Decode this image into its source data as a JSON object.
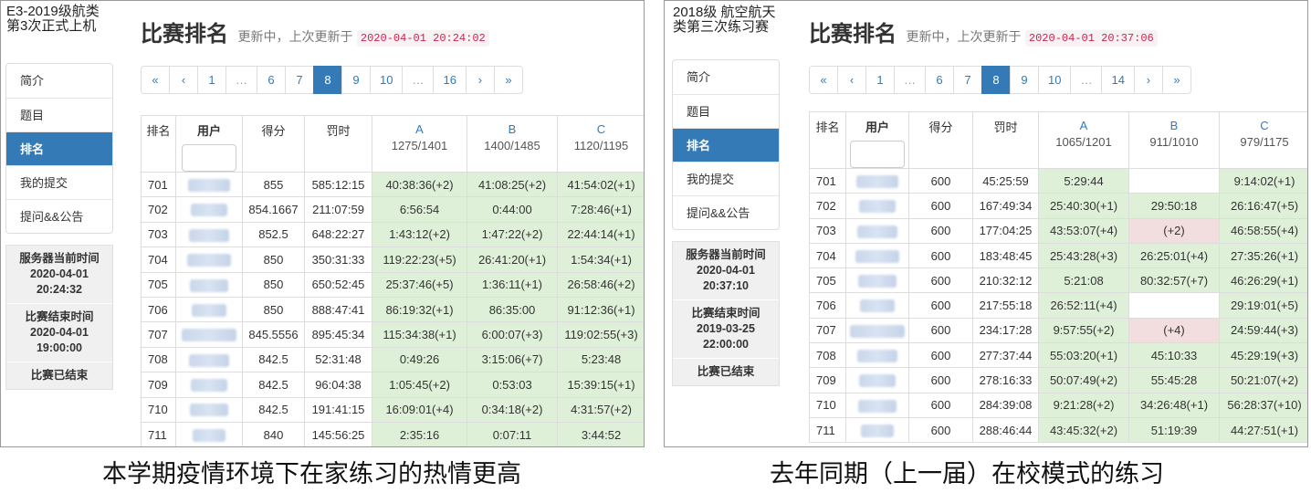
{
  "left": {
    "contest_title": "E3-2019级航类第3次正式上机",
    "nav": [
      "简介",
      "题目",
      "排名",
      "我的提交",
      "提问&&公告"
    ],
    "nav_active": 2,
    "info": {
      "server_time_label": "服务器当前时间",
      "server_date": "2020-04-01",
      "server_clock": "20:24:32",
      "end_label": "比赛结束时间",
      "end_date": "2020-04-01",
      "end_clock": "19:00:00",
      "status": "比赛已结束"
    },
    "heading": {
      "title": "比赛排名",
      "updating": "更新中，上次更新于",
      "timestamp": "2020-04-01 20:24:02"
    },
    "pagination": [
      "«",
      "‹",
      "1",
      "…",
      "6",
      "7",
      "8",
      "9",
      "10",
      "…",
      "16",
      "›",
      "»"
    ],
    "pagination_active": "8",
    "columns": {
      "rank": "排名",
      "user": "用户",
      "score": "得分",
      "penalty": "罚时"
    },
    "problems": [
      {
        "name": "A",
        "stat": "1275/1401"
      },
      {
        "name": "B",
        "stat": "1400/1485"
      },
      {
        "name": "C",
        "stat": "1120/1195"
      }
    ],
    "rows": [
      {
        "rank": "701",
        "score": "855",
        "penalty": "585:12:15",
        "a": "40:38:36(+2)",
        "b": "41:08:25(+2)",
        "c": "41:54:02(+1)"
      },
      {
        "rank": "702",
        "score": "854.1667",
        "penalty": "211:07:59",
        "a": "6:56:54",
        "b": "0:44:00",
        "c": "7:28:46(+1)"
      },
      {
        "rank": "703",
        "score": "852.5",
        "penalty": "648:22:27",
        "a": "1:43:12(+2)",
        "b": "1:47:22(+2)",
        "c": "22:44:14(+1)"
      },
      {
        "rank": "704",
        "score": "850",
        "penalty": "350:31:33",
        "a": "119:22:23(+5)",
        "b": "26:41:20(+1)",
        "c": "1:54:34(+1)"
      },
      {
        "rank": "705",
        "score": "850",
        "penalty": "650:52:45",
        "a": "25:37:46(+5)",
        "b": "1:36:11(+1)",
        "c": "26:58:46(+2)"
      },
      {
        "rank": "706",
        "score": "850",
        "penalty": "888:47:41",
        "a": "86:19:32(+1)",
        "b": "86:35:00",
        "c": "91:12:36(+1)"
      },
      {
        "rank": "707",
        "score": "845.5556",
        "penalty": "895:45:34",
        "a": "115:34:38(+1)",
        "b": "6:00:07(+3)",
        "c": "119:02:55(+3)"
      },
      {
        "rank": "708",
        "score": "842.5",
        "penalty": "52:31:48",
        "a": "0:49:26",
        "b": "3:15:06(+7)",
        "c": "5:23:48"
      },
      {
        "rank": "709",
        "score": "842.5",
        "penalty": "96:04:38",
        "a": "1:05:45(+2)",
        "b": "0:53:03",
        "c": "15:39:15(+1)"
      },
      {
        "rank": "710",
        "score": "842.5",
        "penalty": "191:41:15",
        "a": "16:09:01(+4)",
        "b": "0:34:18(+2)",
        "c": "4:31:57(+2)"
      },
      {
        "rank": "711",
        "score": "840",
        "penalty": "145:56:25",
        "a": "2:35:16",
        "b": "0:07:11",
        "c": "3:44:52"
      }
    ],
    "caption": "本学期疫情环境下在家练习的热情更高"
  },
  "right": {
    "contest_title": "2018级 航空航天类第三次练习赛",
    "nav": [
      "简介",
      "题目",
      "排名",
      "我的提交",
      "提问&&公告"
    ],
    "nav_active": 2,
    "info": {
      "server_time_label": "服务器当前时间",
      "server_date": "2020-04-01",
      "server_clock": "20:37:10",
      "end_label": "比赛结束时间",
      "end_date": "2019-03-25",
      "end_clock": "22:00:00",
      "status": "比赛已结束"
    },
    "heading": {
      "title": "比赛排名",
      "updating": "更新中，上次更新于",
      "timestamp": "2020-04-01 20:37:06"
    },
    "pagination": [
      "«",
      "‹",
      "1",
      "…",
      "6",
      "7",
      "8",
      "9",
      "10",
      "…",
      "14",
      "›",
      "»"
    ],
    "pagination_active": "8",
    "columns": {
      "rank": "排名",
      "user": "用户",
      "score": "得分",
      "penalty": "罚时"
    },
    "problems": [
      {
        "name": "A",
        "stat": "1065/1201"
      },
      {
        "name": "B",
        "stat": "911/1010"
      },
      {
        "name": "C",
        "stat": "979/1175"
      }
    ],
    "rows": [
      {
        "rank": "701",
        "score": "600",
        "penalty": "45:25:59",
        "a": "5:29:44",
        "b": "",
        "c": "9:14:02(+1)",
        "b_state": "none"
      },
      {
        "rank": "702",
        "score": "600",
        "penalty": "167:49:34",
        "a": "25:40:30(+1)",
        "b": "29:50:18",
        "c": "26:16:47(+5)"
      },
      {
        "rank": "703",
        "score": "600",
        "penalty": "177:04:25",
        "a": "43:53:07(+4)",
        "b": "(+2)",
        "c": "46:58:55(+4)",
        "b_state": "wa"
      },
      {
        "rank": "704",
        "score": "600",
        "penalty": "183:48:45",
        "a": "25:43:28(+3)",
        "b": "26:25:01(+4)",
        "c": "27:35:26(+1)"
      },
      {
        "rank": "705",
        "score": "600",
        "penalty": "210:32:12",
        "a": "5:21:08",
        "b": "80:32:57(+7)",
        "c": "46:26:29(+1)"
      },
      {
        "rank": "706",
        "score": "600",
        "penalty": "217:55:18",
        "a": "26:52:11(+4)",
        "b": "",
        "c": "29:19:01(+5)",
        "b_state": "none"
      },
      {
        "rank": "707",
        "score": "600",
        "penalty": "234:17:28",
        "a": "9:57:55(+2)",
        "b": "(+4)",
        "c": "24:59:44(+3)",
        "b_state": "wa"
      },
      {
        "rank": "708",
        "score": "600",
        "penalty": "277:37:44",
        "a": "55:03:20(+1)",
        "b": "45:10:33",
        "c": "45:29:19(+3)"
      },
      {
        "rank": "709",
        "score": "600",
        "penalty": "278:16:33",
        "a": "50:07:49(+2)",
        "b": "55:45:28",
        "c": "50:21:07(+2)"
      },
      {
        "rank": "710",
        "score": "600",
        "penalty": "284:39:08",
        "a": "9:21:28(+2)",
        "b": "34:26:48(+1)",
        "c": "56:28:37(+10)"
      },
      {
        "rank": "711",
        "score": "600",
        "penalty": "288:46:44",
        "a": "43:45:32(+2)",
        "b": "51:19:39",
        "c": "44:27:51(+1)"
      }
    ],
    "caption": "去年同期（上一届）在校模式的练习"
  }
}
